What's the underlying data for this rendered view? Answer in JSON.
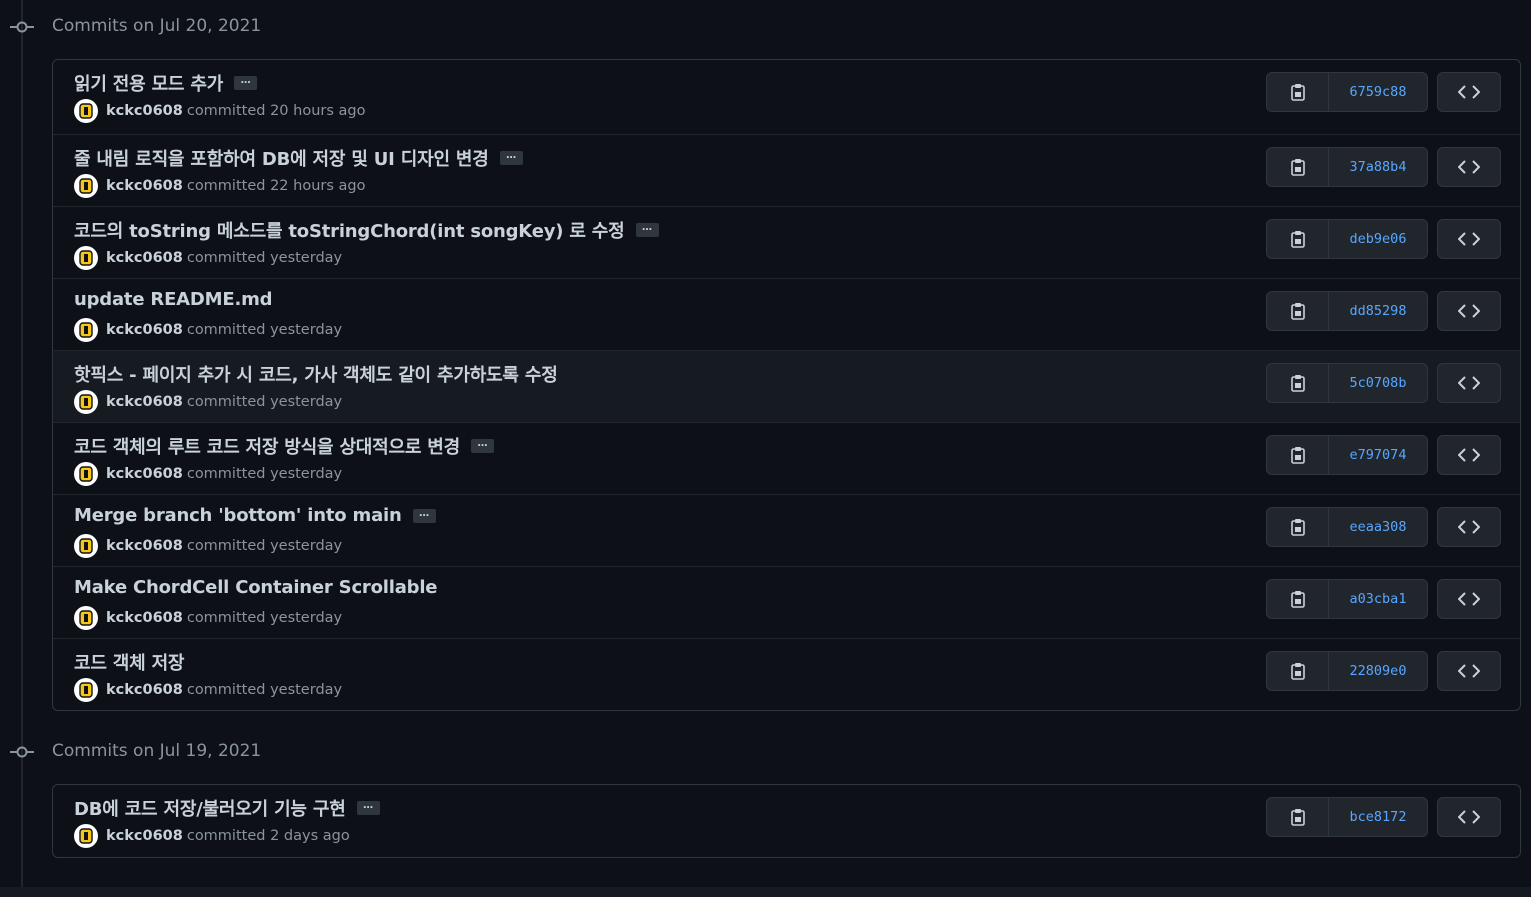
{
  "groups": [
    {
      "title": "Commits on Jul 20, 2021",
      "commits": [
        {
          "message": "읽기 전용 모드 추가",
          "ellipsis": "…",
          "author": "kckc0608",
          "meta": "committed 20 hours ago",
          "sha": "6759c88"
        },
        {
          "message": "줄 내림 로직을 포함하여 DB에 저장 및 UI 디자인 변경",
          "ellipsis": "…",
          "author": "kckc0608",
          "meta": "committed 22 hours ago",
          "sha": "37a88b4"
        },
        {
          "message": "코드의 toString 메소드를 toStringChord(int songKey) 로 수정",
          "ellipsis": "…",
          "author": "kckc0608",
          "meta": "committed yesterday",
          "sha": "deb9e06"
        },
        {
          "message": "update README.md",
          "author": "kckc0608",
          "meta": "committed yesterday",
          "sha": "dd85298"
        },
        {
          "message": "핫픽스 - 페이지 추가 시 코드, 가사 객체도 같이 추가하도록 수정",
          "author": "kckc0608",
          "meta": "committed yesterday",
          "sha": "5c0708b"
        },
        {
          "message": "코드 객체의 루트 코드 저장 방식을 상대적으로 변경",
          "ellipsis": "…",
          "author": "kckc0608",
          "meta": "committed yesterday",
          "sha": "e797074"
        },
        {
          "message": "Merge branch 'bottom' into main",
          "ellipsis": "…",
          "author": "kckc0608",
          "meta": "committed yesterday",
          "sha": "eeaa308"
        },
        {
          "message": "Make ChordCell Container Scrollable",
          "author": "kckc0608",
          "meta": "committed yesterday",
          "sha": "a03cba1"
        },
        {
          "message": "코드 객체 저장",
          "author": "kckc0608",
          "meta": "committed yesterday",
          "sha": "22809e0"
        }
      ]
    },
    {
      "title": "Commits on Jul 19, 2021",
      "commits": [
        {
          "message": "DB에 코드 저장/불러오기 기능 구현",
          "ellipsis": "…",
          "author": "kckc0608",
          "meta": "committed 2 days ago",
          "sha": "bce8172"
        }
      ]
    }
  ],
  "icons": {
    "timeline": "git-commit-icon",
    "copy": "clipboard-icon",
    "browse": "code-icon",
    "avatar": "avatar-icon"
  },
  "colors": {
    "background": "#0d1117",
    "border": "#30363d",
    "sha_link": "#58a6ff",
    "muted_text": "#8b949e",
    "avatar_yellow": "#f5c518",
    "highlight_row": "#161b22"
  }
}
